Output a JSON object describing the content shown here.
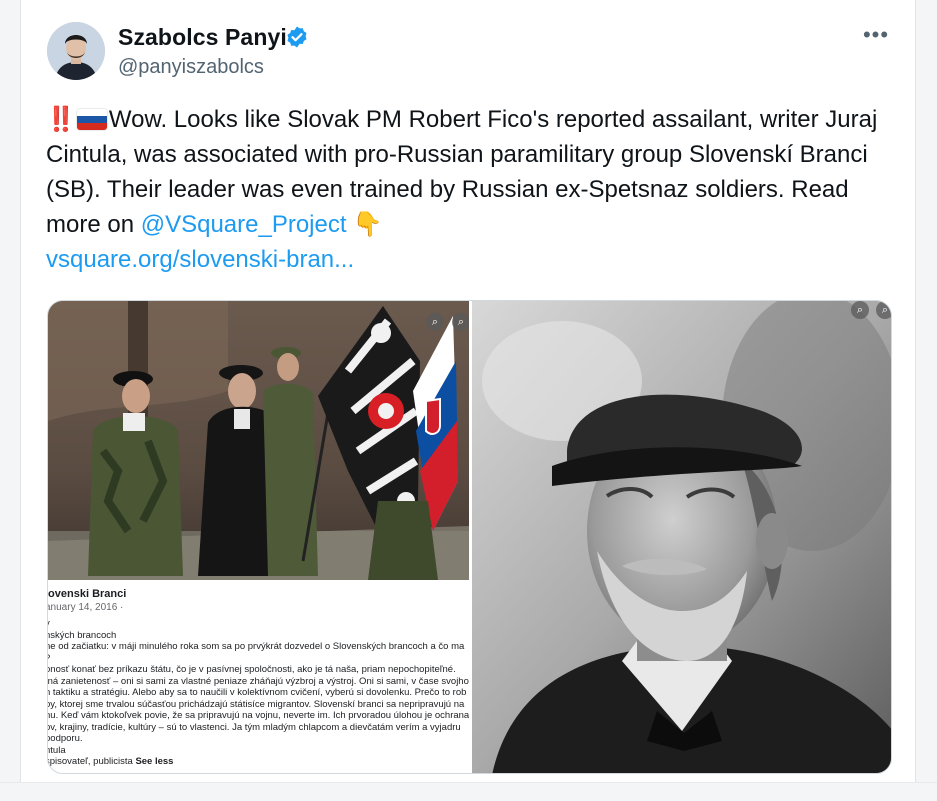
{
  "author": {
    "display_name": "Szabolcs Panyi",
    "handle": "@panyiszabolcs",
    "verified": true
  },
  "more_label": "•••",
  "tweet": {
    "prefix": "‼️",
    "text_main": "Wow. Looks like Slovak PM Robert Fico's reported assailant, writer Juraj Cintula, was associated with pro-Russian paramilitary group Slovenskí Branci (SB). Their leader was even trained by Russian ex-Spetsnaz soldiers. Read more on ",
    "mention": "@VSquare_Project",
    "emoji_hand": "👇",
    "link": "vsquare.org/slovenski-bran..."
  },
  "colors": {
    "link": "#1d9bf0",
    "verified": "#1d9bf0",
    "bang": "#d1242f"
  },
  "flag_icon": "russia-flag-icon",
  "media": {
    "fb_post": {
      "page_name": "lovenski Branci",
      "date": "anuary 14, 2016 · ",
      "lines": [
        "y",
        "nských brancoch",
        "ne od začiatku: v máji minulého roka som sa po prvýkrát dozvedel o Slovenských brancoch a čo ma",
        "?",
        "onosť konať bez príkazu štátu, čo je v pasívnej spoločnosti, ako je tá naša, priam nepochopiteľné.",
        "tná zanietenosť – oni si sami za vlastné peniaze zháňajú výzbroj a výstroj. Oni si sami, v čase svojho",
        "n taktiku a stratégiu. Alebo aby sa to naučili v kolektívnom cvičení, vyberú si dovolenku. Prečo to rob",
        "py, ktorej sme trvalou súčasťou prichádzajú státisíce migrantov. Slovenskí branci sa nepripravujú na",
        "nu. Keď vám ktokoľvek povie, že sa pripravujú na vojnu, neverte im. Ich prvoradou úlohou je ochrana",
        "ov, krajiny, tradície, kultúry – sú to vlastenci. Ja tým mladým chlapcom a dievčatám verím a vyjadru",
        " podporu.",
        "ntula",
        "spisovateľ, publicista "
      ],
      "see_less": "See less"
    }
  }
}
